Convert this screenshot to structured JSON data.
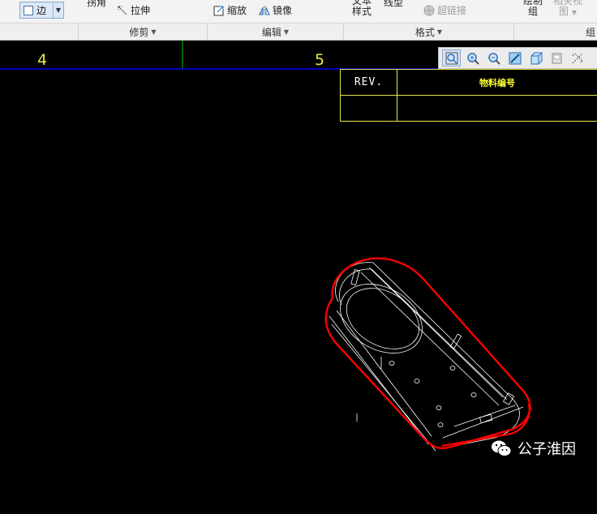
{
  "ribbon": {
    "edge_select_label": "边",
    "items": {
      "offset_label": "拐角",
      "stretch_label": "拉伸",
      "scale_label": "缩放",
      "mirror_label": "镜像",
      "text_style_line1": "文本",
      "text_style_line2": "样式",
      "line_type_label": "线型",
      "hyperlink_label": "超链接",
      "draw_group_line1": "绘制",
      "draw_group_line2": "组",
      "related_view_line1": "相关视",
      "related_view_line2": "图"
    },
    "groups": {
      "trim": "修剪",
      "edit": "编辑",
      "format": "格式",
      "group_partial": "组"
    }
  },
  "drawing": {
    "zone_left": "4",
    "zone_right": "5",
    "title_block": {
      "rev_label": "REV.",
      "part_number_label": "物料编号"
    },
    "line_colors": {
      "border": "#0000ff",
      "zone_divider": "#00cc00",
      "title_block": "#e6e64d",
      "model_highlight": "#ff0000",
      "model_edges": "#ffffff"
    }
  },
  "view_toolbar": {
    "buttons": [
      "refit-icon",
      "zoom-in-icon",
      "zoom-out-icon",
      "repaint-icon",
      "display-style-icon",
      "saved-views-icon",
      "datum-display-icon"
    ]
  },
  "watermark": {
    "text": "公子淮因"
  }
}
